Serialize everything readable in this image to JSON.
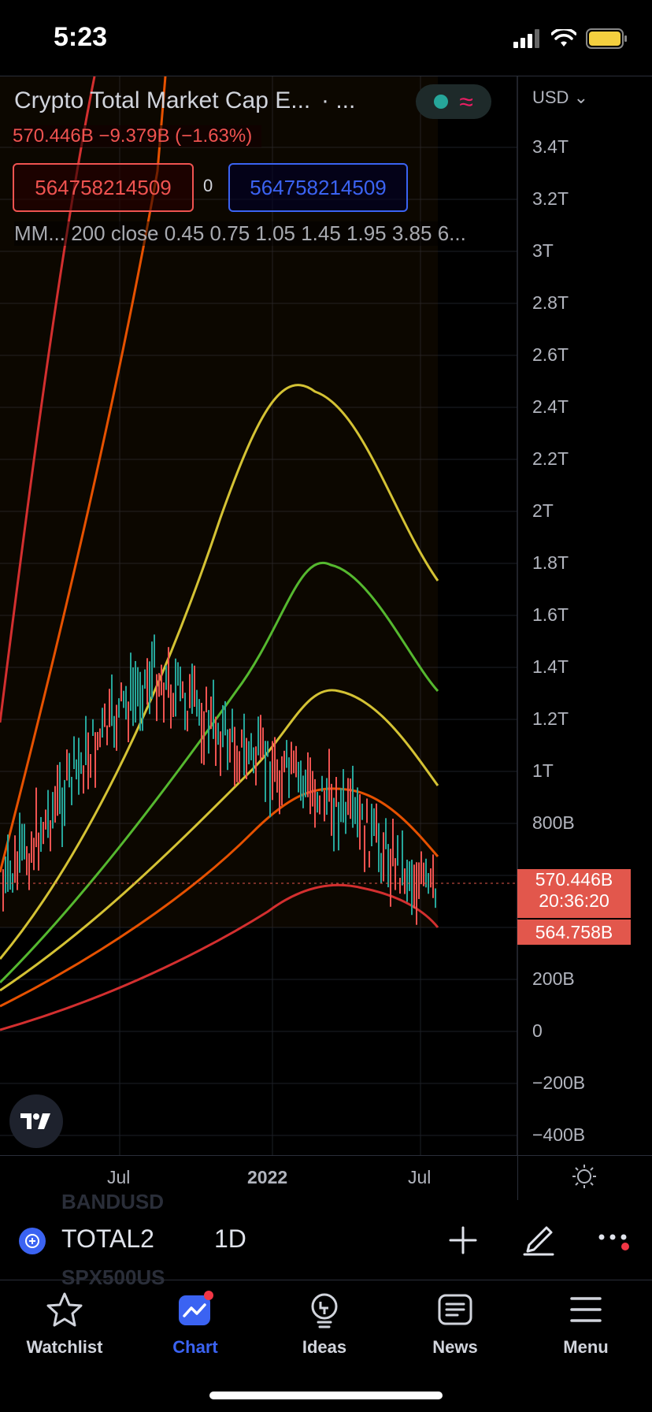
{
  "status_bar": {
    "time": "5:23"
  },
  "legend": {
    "title": "Crypto Total Market Cap E...",
    "dots": "· ...",
    "price_line": "570.446B  −9.379B (−1.63%)",
    "value_left": "564758214509",
    "value_mid": "0",
    "value_right": "564758214509",
    "indicator": "MM... 200 close 0.45 0.75 1.05 1.45 1.95 3.85 6..."
  },
  "price_axis": {
    "currency": "USD",
    "labels": [
      "3.4T",
      "3.2T",
      "3T",
      "2.8T",
      "2.6T",
      "2.4T",
      "2.2T",
      "2T",
      "1.8T",
      "1.6T",
      "1.4T",
      "1.2T",
      "1T",
      "800B",
      "200B",
      "0",
      "−200B",
      "−400B"
    ]
  },
  "price_tags": {
    "last": "570.446B",
    "countdown": "20:36:20",
    "indicator_value": "564.758B"
  },
  "time_axis": {
    "labels": [
      "Jul",
      "2022",
      "Jul"
    ]
  },
  "ghost_text": {
    "top": "BANDUSD",
    "bottom": "SPX500US"
  },
  "toolbar": {
    "symbol": "TOTAL2",
    "interval": "1D"
  },
  "tabs": [
    {
      "label": "Watchlist",
      "icon": "star-icon"
    },
    {
      "label": "Chart",
      "icon": "chart-icon"
    },
    {
      "label": "Ideas",
      "icon": "lightbulb-icon"
    },
    {
      "label": "News",
      "icon": "news-icon"
    },
    {
      "label": "Menu",
      "icon": "menu-icon"
    }
  ],
  "colors": {
    "background": "#000000",
    "accent": "#3b63f2",
    "down": "#ef5350",
    "up": "#26a69a",
    "price_tag": "#e2574c"
  }
}
